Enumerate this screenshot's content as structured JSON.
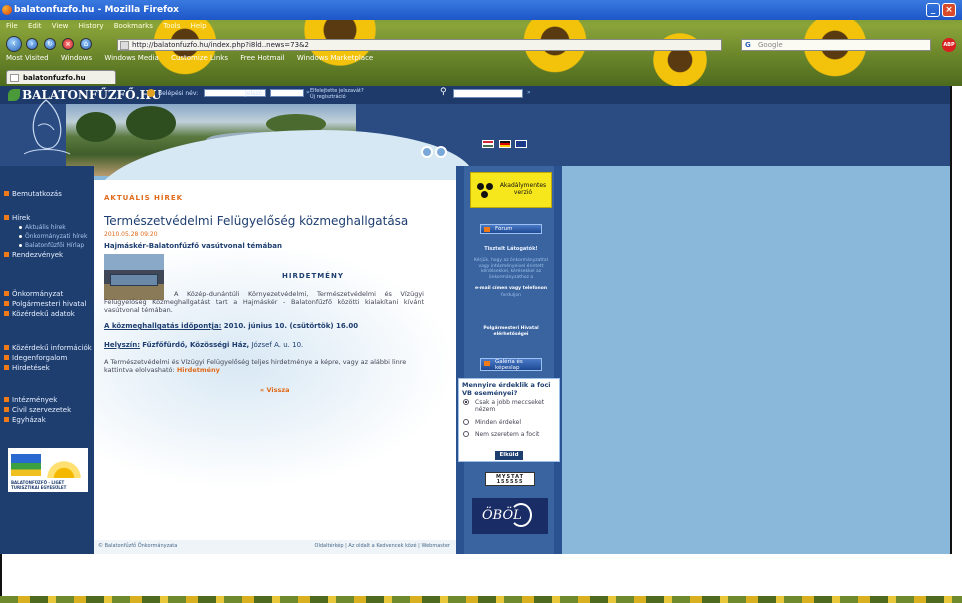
{
  "browser": {
    "title": "balatonfuzfo.hu - Mozilla Firefox",
    "menu": [
      "File",
      "Edit",
      "View",
      "History",
      "Bookmarks",
      "Tools",
      "Help"
    ],
    "url": "http://balatonfuzfo.hu/index.php?i8ld..news=73&2",
    "search_placeholder": "Google",
    "bookmarks": [
      "Most Visited",
      "Windows",
      "Windows Media",
      "Customize Links",
      "Free Hotmail",
      "Windows Marketplace"
    ],
    "tab_label": "balatonfuzfo.hu"
  },
  "site": {
    "logo": "BALATONFŰZFŐ.HU",
    "login": {
      "user_label": "Belépési név:",
      "pass_label": "Jelszó:",
      "forgot_line1": "Elfelejtette jelszavát?",
      "forgot_line2": "Új regisztráció"
    }
  },
  "sidebar": {
    "items_a": [
      {
        "label": "Bemutatkozás"
      }
    ],
    "hirek": "Hírek",
    "hirek_subs": [
      "Aktuális hírek",
      "Önkormányzati hírek",
      "Balatonfűzfői Hírlap"
    ],
    "items_b": [
      "Rendezvények"
    ],
    "items_c": [
      "Önkormányzat",
      "Polgármesteri hivatal",
      "Közérdekű adatok"
    ],
    "items_d": [
      "Közérdekű információk",
      "Idegenforgalom",
      "Hirdetések"
    ],
    "items_e": [
      "Intézmények",
      "Civil szervezetek",
      "Egyházak"
    ],
    "banner_text": "BALATONFŰZFŐ - LIGET TURISZTIKAI EGYESÜLET"
  },
  "article": {
    "section_title": "AKTUÁLIS HÍREK",
    "title": "Természetvédelmi Felügyelőség közmeghallgatása",
    "date": "2010.05.28 09:20",
    "subtitle": "Hajmáskér-Balatonfűzfő vasútvonal témában",
    "hirdetmeny": "HIRDETMÉNY",
    "body": "A Közép-dunántúli Környezetvédelmi, Természetvédelmi és Vízügyi Felügyelőség Közmeghallgatást tart a Hajmáskér - Balatonfűzfő közötti kialakítani kívánt vasútvonal témában.",
    "time_label": "A közmeghallgatás időpontja:",
    "time_value": "2010. június 10. (csütörtök) 16.00",
    "place_label": "Helyszín:",
    "place_value": "Fűzfőfürdő, Közösségi Ház,",
    "place_addr": "József A. u. 10.",
    "more_text": "A Természetvédelmi és Vízügyi Felügyelőség teljes hirdetménye a képre, vagy az alábbi linre kattintva elolvasható:",
    "more_link": "Hirdetmény",
    "back": "« Vissza"
  },
  "footer": {
    "left": "© Balatonfűzfő Önkormányzata",
    "right": "Oldaltérkép | Az oldalt a Kedvencek közé | Webmaster"
  },
  "right": {
    "accessible": "Akadálymentes verzió",
    "forum": "Fórum",
    "contact_heading": "Tisztelt Látogatók!",
    "contact_text": "Kérjük, hogy az önkormányzattal vagy intézményeivel érintett kérdésekkel, kérésekkel az önkormányzathoz a",
    "contact_bold": "e-mail címen vagy telefonon",
    "contact_tail": "forduljon",
    "office_bold": "Polgármesteri Hivatal elérhetőségei",
    "gallery": "Galéria és képeslap",
    "poll_title": "Mennyire érdeklik a foci VB eseményei?",
    "poll_options": [
      "Csak a jobb meccseket nézem",
      "Minden érdekel",
      "Nem szeretem a focit"
    ],
    "poll_submit": "Elküld",
    "mystat": "MYSTAT 155555",
    "obol": "ÖBÖL"
  },
  "colors": {
    "accent_orange": "#e06a1a",
    "nav_blue": "#1e3e70",
    "yellow_box": "#f6e61c"
  }
}
